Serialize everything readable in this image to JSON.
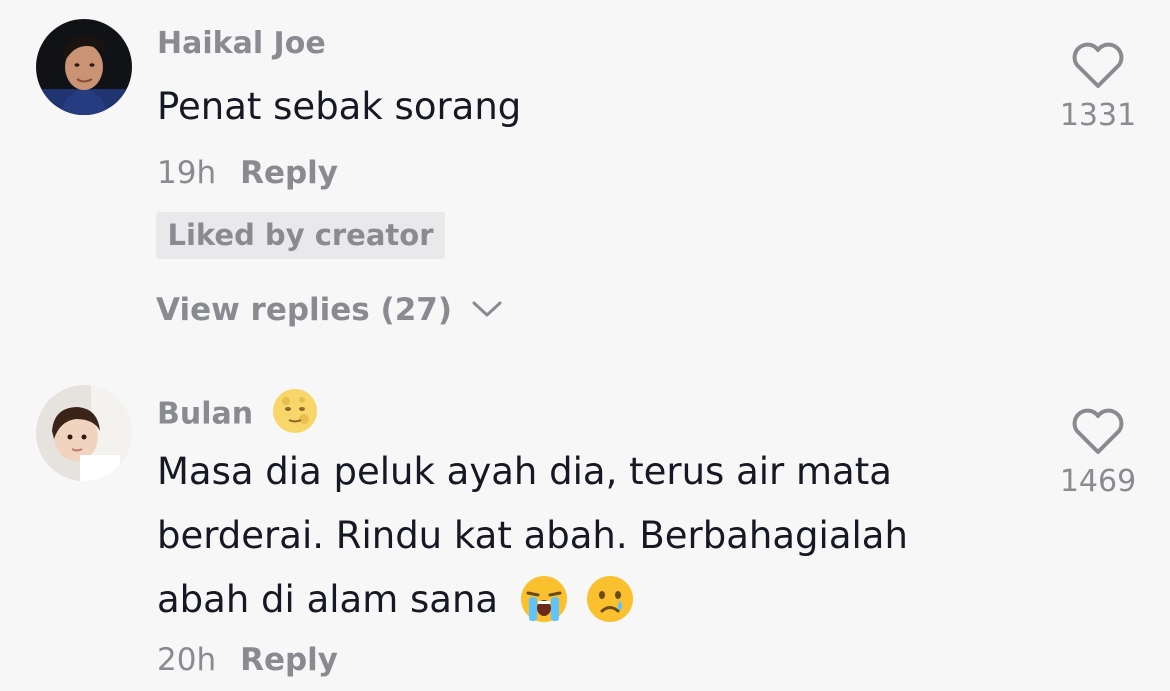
{
  "comments": [
    {
      "username": "Haikal Joe",
      "text_lines": [
        "Penat sebak sorang"
      ],
      "time": "19h",
      "reply_label": "Reply",
      "badge": "Liked by creator",
      "view_replies": "View replies (27)",
      "like_count": "1331"
    },
    {
      "username": "Bulan",
      "text_lines": [
        "Masa dia peluk ayah dia, terus air mata",
        "berderai. Rindu kat abah. Berbahagialah",
        "abah di alam sana"
      ],
      "time": "20h",
      "reply_label": "Reply",
      "like_count": "1469"
    }
  ],
  "icons": {
    "like": "heart-outline-icon",
    "expand": "chevron-down-icon",
    "username_emoji": "full-moon-face-emoji",
    "comment_emojis": [
      "loudly-crying-face-emoji",
      "crying-face-emoji"
    ]
  },
  "colors": {
    "background": "#f7f7f7",
    "text_primary": "#161823",
    "text_secondary": "#8a8b91",
    "badge_bg": "#e9e9eb"
  }
}
